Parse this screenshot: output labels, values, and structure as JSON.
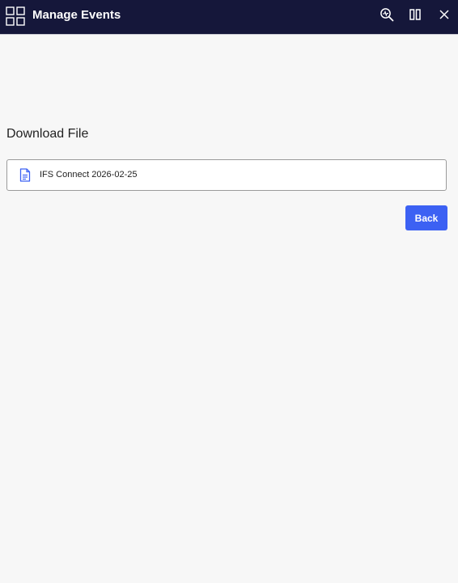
{
  "window": {
    "title": "Manage Events",
    "app_icon": "grid-apps-icon",
    "actions": [
      {
        "icon": "zoom-inspect-icon"
      },
      {
        "icon": "split-view-icon"
      },
      {
        "icon": "close-icon"
      }
    ]
  },
  "main": {
    "section_title": "Download File",
    "files": [
      {
        "icon": "document-icon",
        "name": "IFS Connect 2026-02-25"
      }
    ],
    "back_label": "Back"
  },
  "colors": {
    "titlebar_bg": "#15173a",
    "accent": "#3c61f3",
    "background": "#f7f7f7"
  }
}
